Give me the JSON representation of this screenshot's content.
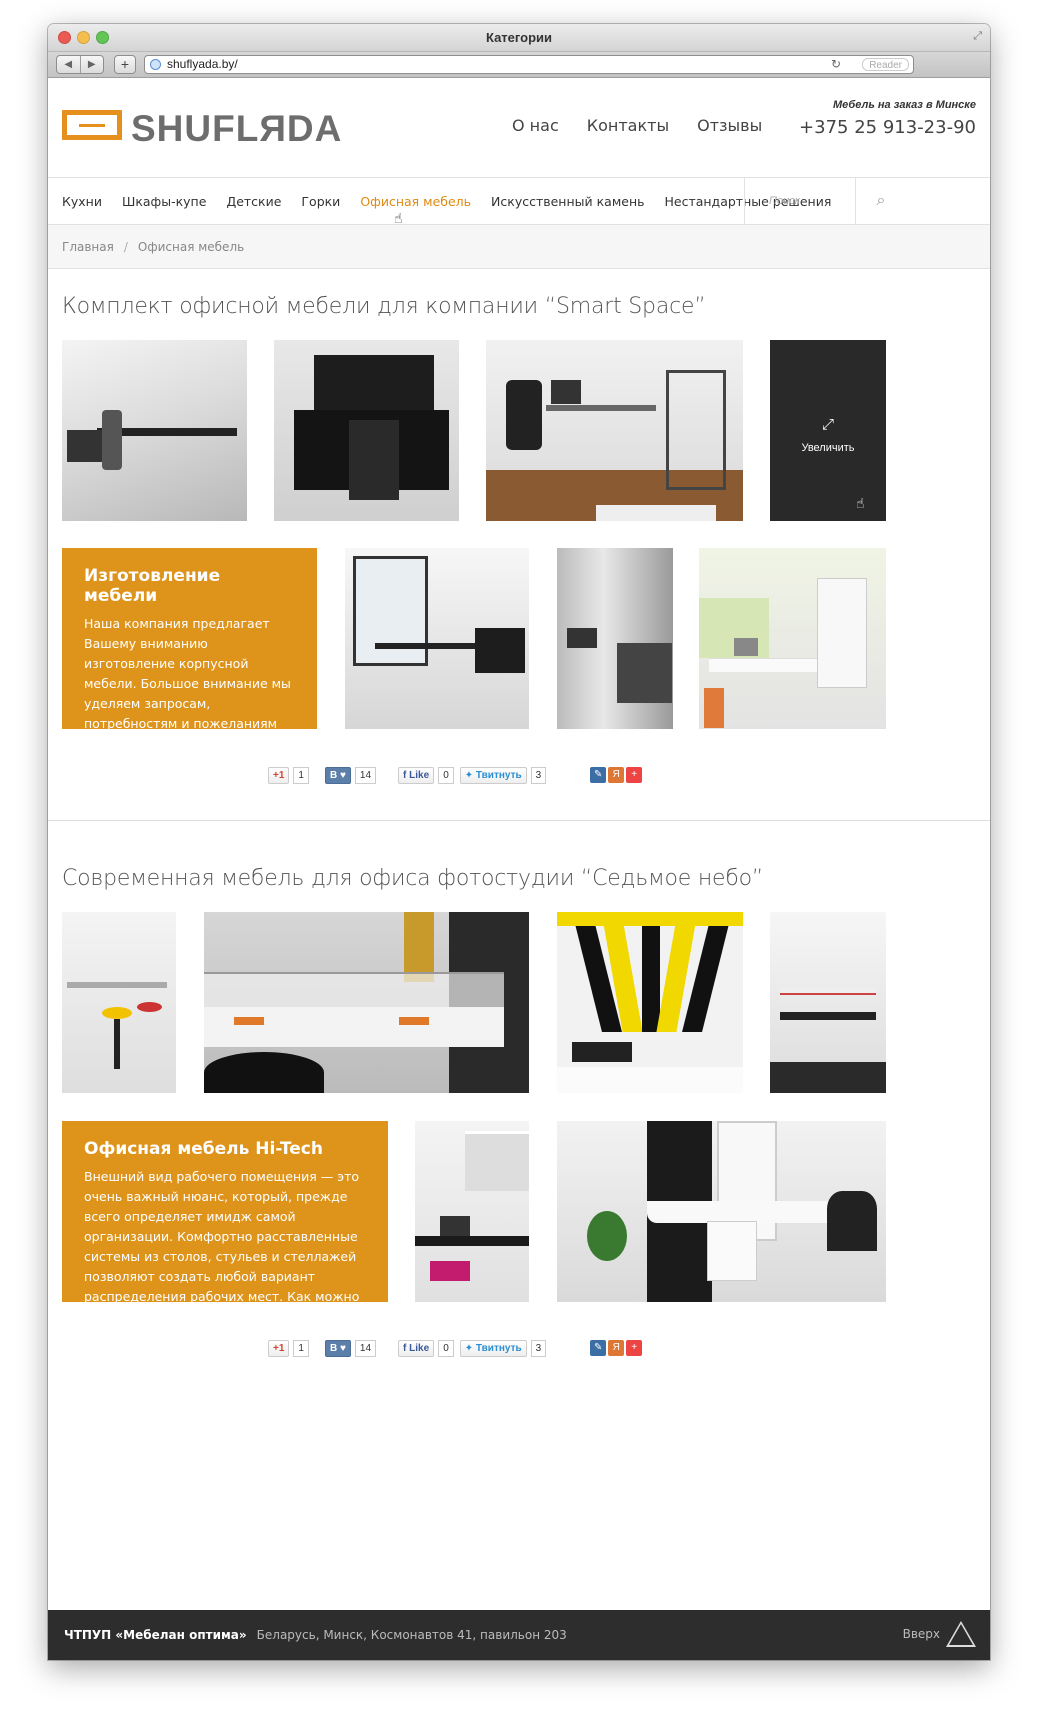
{
  "window": {
    "title": "Категории",
    "url": "shuflyada.by/",
    "reader_label": "Reader"
  },
  "header": {
    "logo": "SHUFLЯDA",
    "nav": [
      "О нас",
      "Контакты",
      "Отзывы"
    ],
    "tagline": "Мебель на заказ в Минске",
    "phone": "+375 25 913-23-90"
  },
  "categories": [
    "Кухни",
    "Шкафы-купе",
    "Детские",
    "Горки",
    "Офисная мебель",
    "Искусственный камень",
    "Нестандартные решения"
  ],
  "active_category": "Офисная мебель",
  "search": {
    "placeholder": "Поиск"
  },
  "breadcrumb": [
    "Главная",
    "Офисная мебель"
  ],
  "sections": [
    {
      "title": "Комплект офисной мебели для компании “Smart Space”",
      "zoom_label": "Увеличить",
      "box": {
        "heading": "Изготовление мебели",
        "text": "Наша компания предлагает Вашему вниманию изготовление корпусной мебели. Большое внимание мы уделяем запросам, потребностям и пожеланиям  заказчиков. Мы готовы предложить своим клиентам высококачественный результат."
      },
      "share": {
        "gplus": "+1",
        "gplus_count": "1",
        "vk": "В",
        "vk_count": "14",
        "fb": "Like",
        "fb_count": "0",
        "tw": "Твитнуть",
        "tw_count": "3"
      }
    },
    {
      "title": "Современная мебель для офиса фотостудии “Седьмое небо”",
      "box": {
        "heading": "Офисная мебель Hi-Tech",
        "text": "Внешний вид рабочего помещения — это очень важный нюанс, который, прежде всего определяет имидж самой организации. Комфортно расставленные системы из столов, стульев и стеллажей позволяют создать любой вариант распределения рабочих мест. Как можно ознакомиться из демонстрационных."
      },
      "share": {
        "gplus": "+1",
        "gplus_count": "1",
        "vk": "В",
        "vk_count": "14",
        "fb": "Like",
        "fb_count": "0",
        "tw": "Твитнуть",
        "tw_count": "3"
      }
    }
  ],
  "footer": {
    "company": "ЧТПУП «Мебелан оптима»",
    "address": "Беларусь, Минск, Космонавтов 41, павильон 203",
    "up_label": "Вверх"
  },
  "colors": {
    "accent": "#de931b",
    "footer_bg": "#2d2d2d"
  }
}
